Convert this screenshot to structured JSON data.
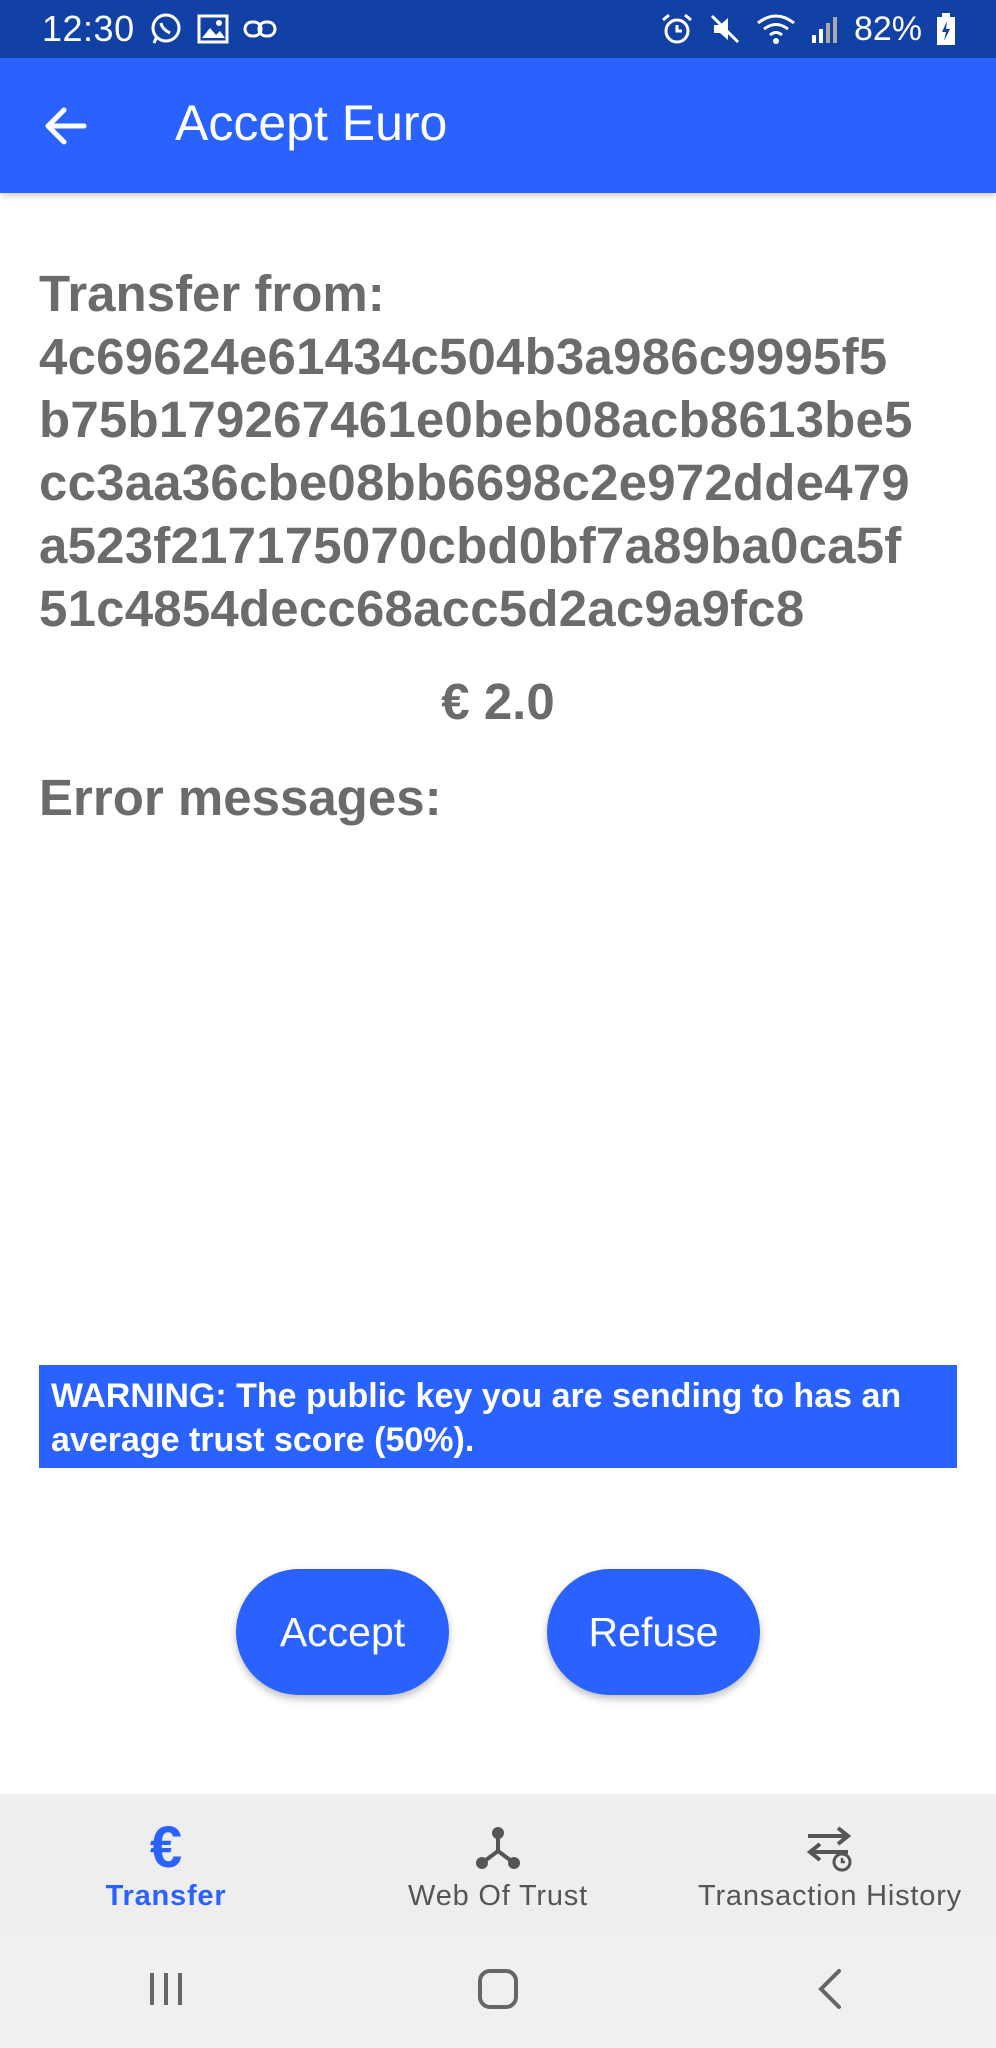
{
  "status_bar": {
    "time": "12:30",
    "battery": "82%"
  },
  "app_bar": {
    "title": "Accept Euro"
  },
  "transfer": {
    "label": "Transfer from:",
    "public_key_lines": [
      "4c69624e61434c504b3a986c9995f5",
      "b75b179267461e0beb08acb8613be5",
      "cc3aa36cbe08bb6698c2e972dde479",
      "a523f217175070cbd0bf7a89ba0ca5f",
      "51c4854decc68acc5d2ac9a9fc8"
    ],
    "amount": "€ 2.0"
  },
  "errors": {
    "label": "Error messages:"
  },
  "warning": {
    "text": "WARNING: The public key you are sending to has an average trust score (50%)."
  },
  "actions": {
    "accept_label": "Accept",
    "refuse_label": "Refuse"
  },
  "bottom_nav": {
    "items": [
      {
        "label": "Transfer",
        "icon": "euro-icon",
        "active": true
      },
      {
        "label": "Web Of Trust",
        "icon": "network-icon",
        "active": false
      },
      {
        "label": "Transaction History",
        "icon": "transaction-history-icon",
        "active": false
      }
    ]
  },
  "colors": {
    "status_bar": "#1241a6",
    "primary": "#2962ff",
    "text_gray": "#6b6b6b"
  }
}
